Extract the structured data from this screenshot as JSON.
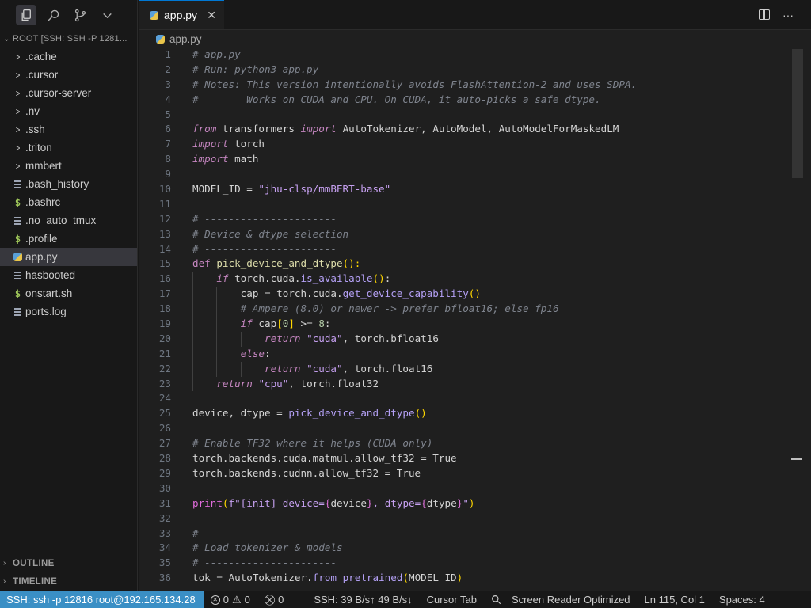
{
  "sidebar": {
    "root_label": "ROOT [SSH: SSH -P 1281...",
    "items": [
      {
        "label": ".cache",
        "type": "folder"
      },
      {
        "label": ".cursor",
        "type": "folder"
      },
      {
        "label": ".cursor-server",
        "type": "folder"
      },
      {
        "label": ".nv",
        "type": "folder"
      },
      {
        "label": ".ssh",
        "type": "folder"
      },
      {
        "label": ".triton",
        "type": "folder"
      },
      {
        "label": "mmbert",
        "type": "folder"
      },
      {
        "label": ".bash_history",
        "type": "file"
      },
      {
        "label": ".bashrc",
        "type": "shell"
      },
      {
        "label": ".no_auto_tmux",
        "type": "file"
      },
      {
        "label": ".profile",
        "type": "shell"
      },
      {
        "label": "app.py",
        "type": "python",
        "active": true
      },
      {
        "label": "hasbooted",
        "type": "file"
      },
      {
        "label": "onstart.sh",
        "type": "shell"
      },
      {
        "label": "ports.log",
        "type": "file"
      }
    ],
    "outline_label": "OUTLINE",
    "timeline_label": "TIMELINE"
  },
  "editor": {
    "tab_label": "app.py",
    "close_glyph": "✕",
    "more_glyph": "···",
    "breadcrumb": "app.py"
  },
  "code": {
    "lines": [
      [
        [
          "cm",
          "# app.py"
        ]
      ],
      [
        [
          "cm",
          "# Run: python3 app.py"
        ]
      ],
      [
        [
          "cm",
          "# Notes: This version intentionally avoids FlashAttention-2 and uses SDPA."
        ]
      ],
      [
        [
          "cm",
          "#        Works on CUDA and CPU. On CUDA, it auto-picks a safe dtype."
        ]
      ],
      [],
      [
        [
          "kw",
          "from"
        ],
        [
          "t",
          " transformers "
        ],
        [
          "kw",
          "import"
        ],
        [
          "t",
          " AutoTokenizer, AutoModel, AutoModelForMaskedLM"
        ]
      ],
      [
        [
          "kw",
          "import"
        ],
        [
          "t",
          " torch"
        ]
      ],
      [
        [
          "kw",
          "import"
        ],
        [
          "t",
          " math"
        ]
      ],
      [],
      [
        [
          "t",
          "MODEL_ID = "
        ],
        [
          "strf",
          "\"jhu-clsp/mmBERT-base\""
        ]
      ],
      [],
      [
        [
          "cm",
          "# ----------------------"
        ]
      ],
      [
        [
          "cm",
          "# Device & dtype selection"
        ]
      ],
      [
        [
          "cm",
          "# ----------------------"
        ]
      ],
      [
        [
          "kwd",
          "def "
        ],
        [
          "fn",
          "pick_device_and_dtype"
        ],
        [
          "paren1",
          "():"
        ]
      ],
      [
        [
          "t",
          "    "
        ],
        [
          "kw",
          "if"
        ],
        [
          "t",
          " torch.cuda."
        ],
        [
          "call",
          "is_available"
        ],
        [
          "paren1",
          "()"
        ],
        [
          "t",
          ":"
        ]
      ],
      [
        [
          "t",
          "        cap = torch.cuda."
        ],
        [
          "call",
          "get_device_capability"
        ],
        [
          "paren1",
          "()"
        ]
      ],
      [
        [
          "t",
          "        "
        ],
        [
          "cm",
          "# Ampere (8.0) or newer -> prefer bfloat16; else fp16"
        ]
      ],
      [
        [
          "t",
          "        "
        ],
        [
          "kw",
          "if"
        ],
        [
          "t",
          " cap"
        ],
        [
          "paren1",
          "["
        ],
        [
          "num",
          "0"
        ],
        [
          "paren1",
          "]"
        ],
        [
          "t",
          " >= "
        ],
        [
          "num",
          "8"
        ],
        [
          "t",
          ":"
        ]
      ],
      [
        [
          "t",
          "            "
        ],
        [
          "kw",
          "return"
        ],
        [
          "t",
          " "
        ],
        [
          "strf",
          "\"cuda\""
        ],
        [
          "t",
          ", torch.bfloat16"
        ]
      ],
      [
        [
          "t",
          "        "
        ],
        [
          "kw",
          "else"
        ],
        [
          "t",
          ":"
        ]
      ],
      [
        [
          "t",
          "            "
        ],
        [
          "kw",
          "return"
        ],
        [
          "t",
          " "
        ],
        [
          "strf",
          "\"cuda\""
        ],
        [
          "t",
          ", torch.float16"
        ]
      ],
      [
        [
          "t",
          "    "
        ],
        [
          "kw",
          "return"
        ],
        [
          "t",
          " "
        ],
        [
          "strf",
          "\"cpu\""
        ],
        [
          "t",
          ", torch.float32"
        ]
      ],
      [],
      [
        [
          "t",
          "device, dtype = "
        ],
        [
          "call",
          "pick_device_and_dtype"
        ],
        [
          "paren1",
          "()"
        ]
      ],
      [],
      [
        [
          "cm",
          "# Enable TF32 where it helps (CUDA only)"
        ]
      ],
      [
        [
          "t",
          "torch.backends.cuda.matmul.allow_tf32 = True"
        ]
      ],
      [
        [
          "t",
          "torch.backends.cudnn.allow_tf32 = True"
        ]
      ],
      [],
      [
        [
          "fnmagenta",
          "print"
        ],
        [
          "paren1",
          "("
        ],
        [
          "strf",
          "f\"[init] device="
        ],
        [
          "paren2",
          "{"
        ],
        [
          "t",
          "device"
        ],
        [
          "paren2",
          "}"
        ],
        [
          "strf",
          ", dtype="
        ],
        [
          "paren2",
          "{"
        ],
        [
          "t",
          "dtype"
        ],
        [
          "paren2",
          "}"
        ],
        [
          "strf",
          "\""
        ],
        [
          "paren1",
          ")"
        ]
      ],
      [],
      [
        [
          "cm",
          "# ----------------------"
        ]
      ],
      [
        [
          "cm",
          "# Load tokenizer & models"
        ]
      ],
      [
        [
          "cm",
          "# ----------------------"
        ]
      ],
      [
        [
          "t",
          "tok = AutoTokenizer."
        ],
        [
          "call",
          "from_pretrained"
        ],
        [
          "paren1",
          "("
        ],
        [
          "t",
          "MODEL_ID"
        ],
        [
          "paren1",
          ")"
        ]
      ]
    ],
    "guides": {
      "16": [
        1
      ],
      "17": [
        1,
        2
      ],
      "18": [
        1,
        2
      ],
      "19": [
        1,
        2
      ],
      "20": [
        1,
        2,
        3
      ],
      "21": [
        1,
        2
      ],
      "22": [
        1,
        2,
        3
      ],
      "23": [
        1
      ]
    }
  },
  "statusbar": {
    "remote": "SSH: ssh -p 12816 root@192.165.134.28",
    "errors": "0",
    "warnings": "0",
    "ports": "0",
    "net": "SSH: 39 B/s↑ 49 B/s↓",
    "cursor_tab": "Cursor Tab",
    "screen_reader": "Screen Reader Optimized",
    "position": "Ln 115, Col 1",
    "spaces": "Spaces: 4"
  }
}
